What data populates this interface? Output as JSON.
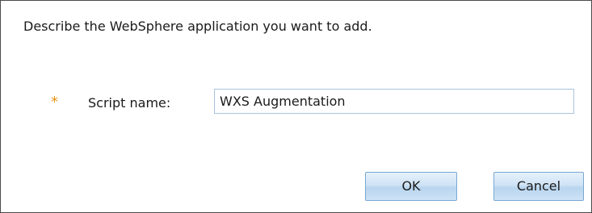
{
  "dialog": {
    "description": "Describe the WebSphere application you want to add.",
    "required_marker": "*",
    "script_name_label": "Script name:",
    "script_name_value": "WXS Augmentation",
    "ok_label": "OK",
    "cancel_label": "Cancel"
  },
  "colors": {
    "required_marker": "#e8941a",
    "button_border": "#7aa8d2",
    "input_border": "#a9c3dc"
  }
}
